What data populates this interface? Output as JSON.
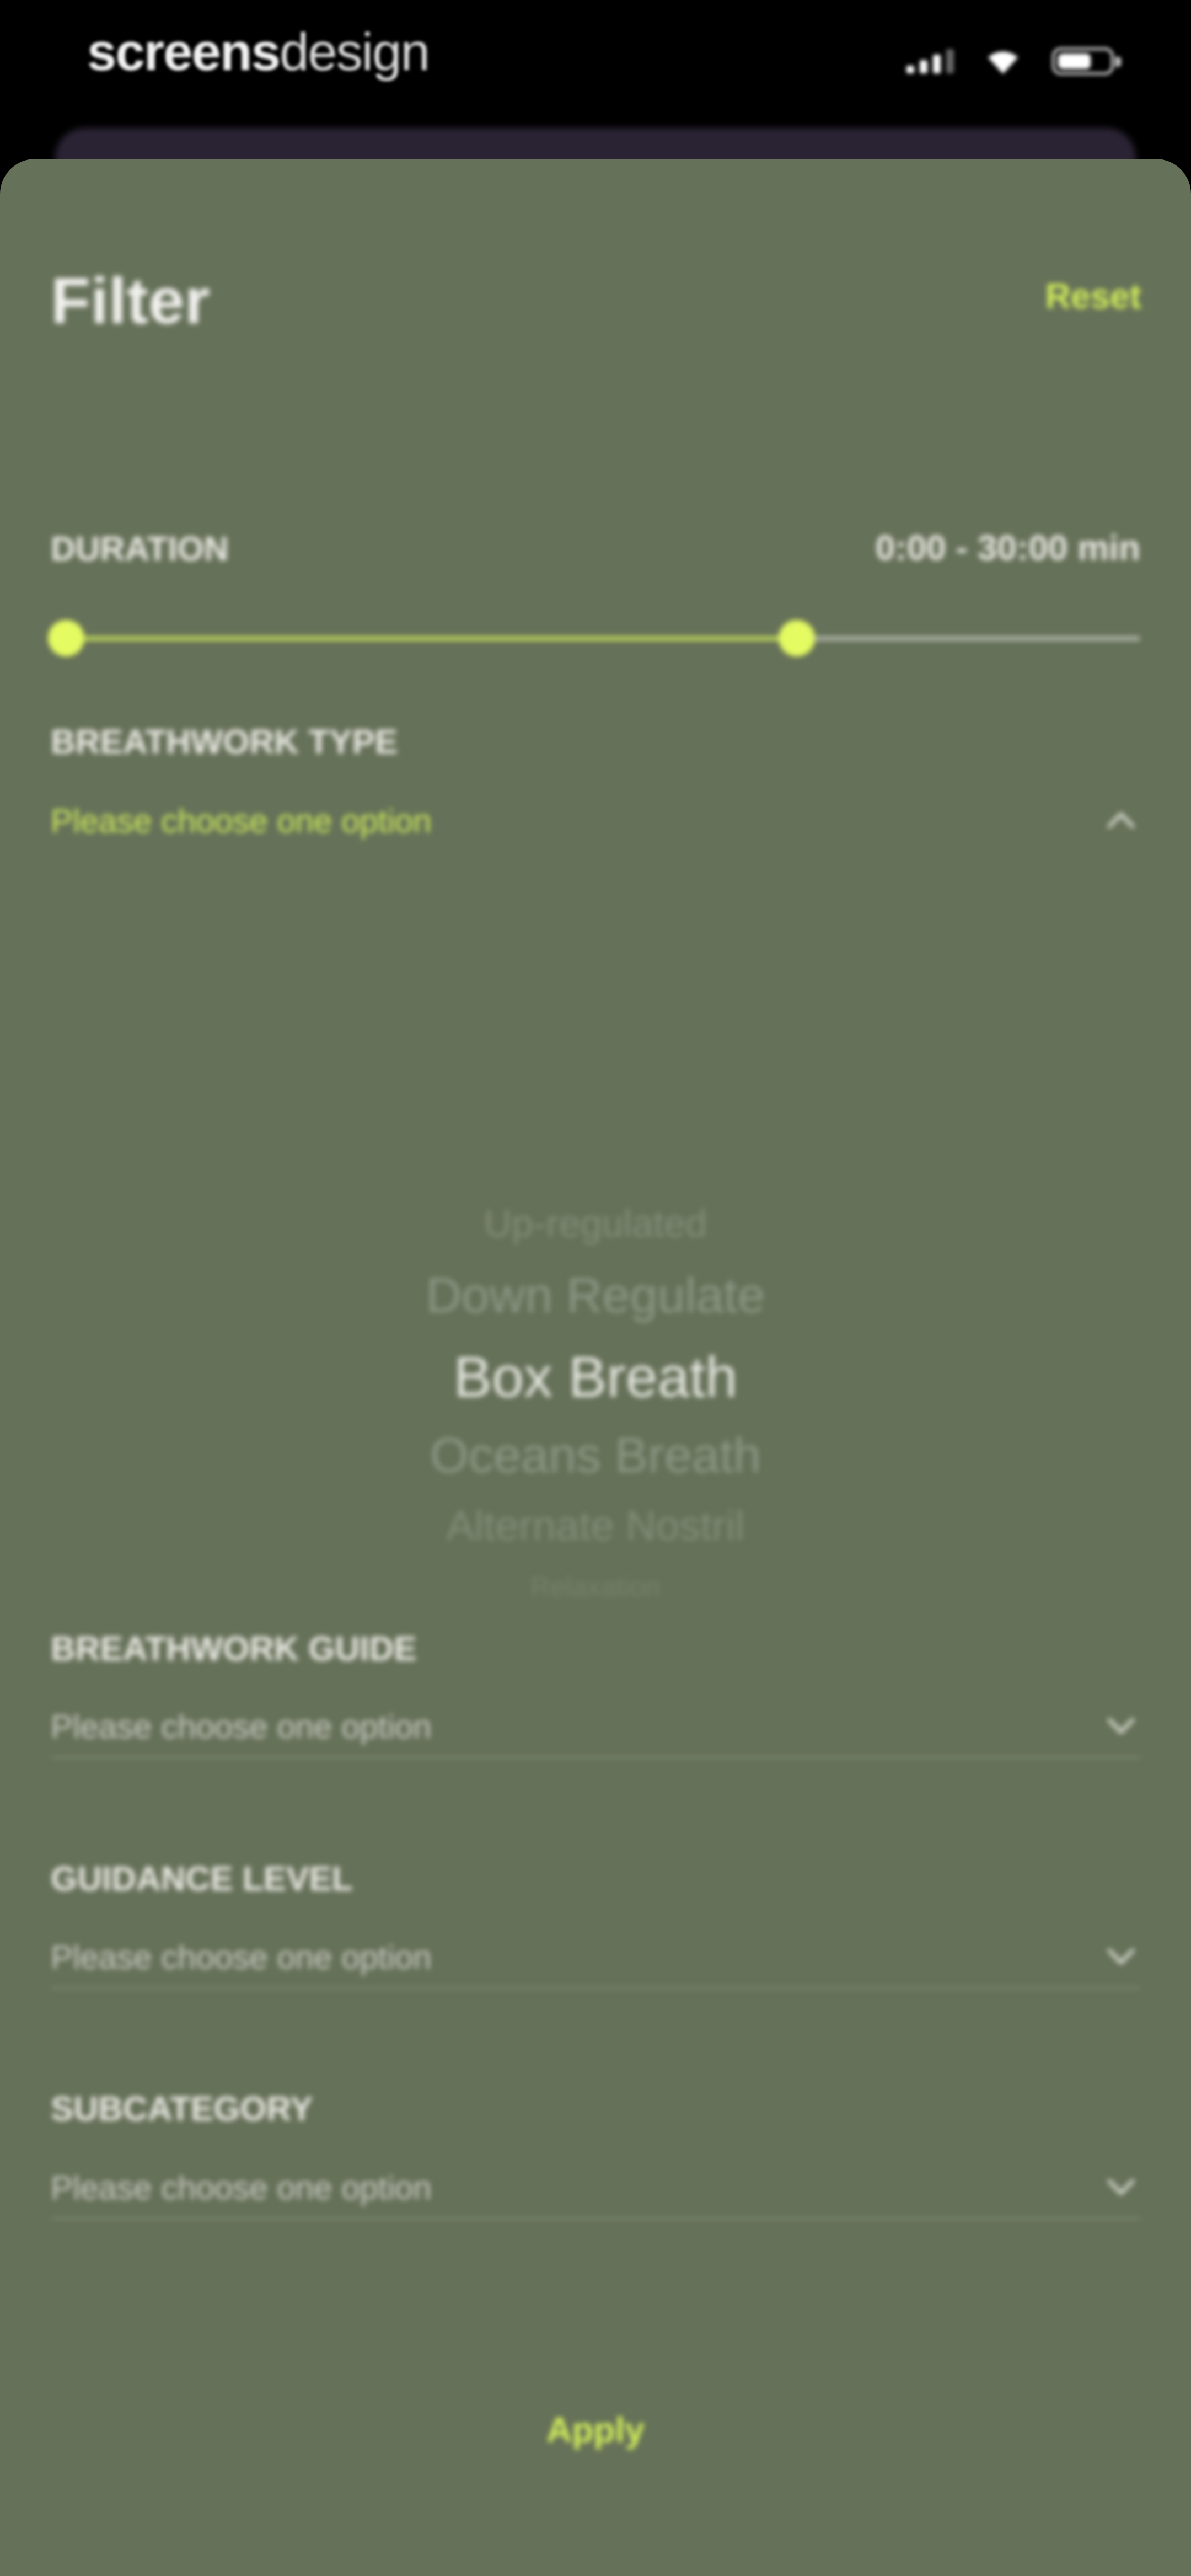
{
  "status_bar": {
    "brand_bold": "screens",
    "brand_light": "design",
    "icons": [
      "signal-icon",
      "wifi-icon",
      "battery-icon"
    ]
  },
  "filter": {
    "title": "Filter",
    "reset_label": "Reset",
    "duration": {
      "label": "DURATION",
      "value_text": "0:00 - 30:00 min",
      "range_min_fraction": 0.0,
      "range_max_fraction": 0.68
    },
    "breathwork_type": {
      "label": "BREATHWORK TYPE",
      "placeholder": "Please choose one option",
      "expanded": true,
      "options": [
        "Up-regulated",
        "Down Regulate",
        "Box Breath",
        "Oceans Breath",
        "Alternate Nostril",
        "Relaxation"
      ],
      "selected": "Box Breath"
    },
    "breathwork_guide": {
      "label": "BREATHWORK GUIDE",
      "placeholder": "Please choose one option"
    },
    "guidance_level": {
      "label": "GUIDANCE LEVEL",
      "placeholder": "Please choose one option"
    },
    "subcategory": {
      "label": "SUBCATEGORY",
      "placeholder": "Please choose one option"
    },
    "apply_label": "Apply"
  },
  "colors": {
    "sheet_background": "#667159",
    "accent": "#d6f35b",
    "text_primary": "#ecece6",
    "text_muted": "#c9cbc2"
  }
}
